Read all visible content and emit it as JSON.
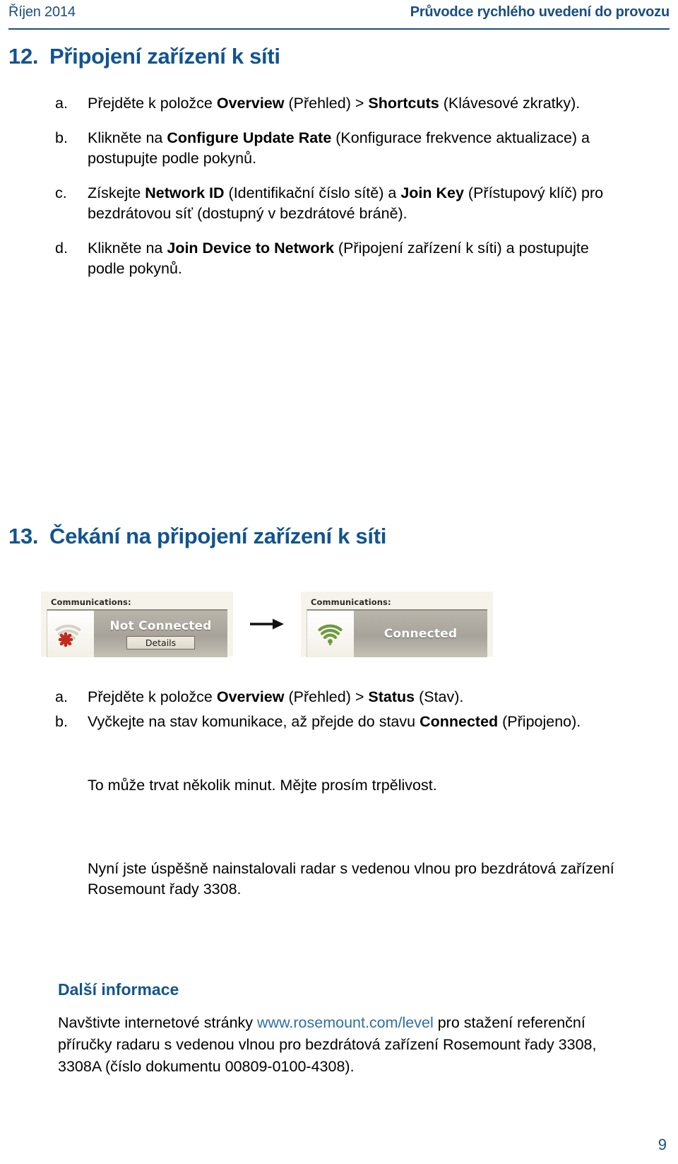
{
  "header": {
    "left": "Říjen 2014",
    "right": "Průvodce rychlého uvedení do provozu"
  },
  "sections": [
    {
      "number": "12.",
      "title": "Připojení zařízení k síti",
      "steps": [
        {
          "marker": "a.",
          "parts": [
            {
              "text": "Přejděte k položce ",
              "bold": false
            },
            {
              "text": "Overview",
              "bold": true
            },
            {
              "text": " (Přehled) > ",
              "bold": false
            },
            {
              "text": "Shortcuts",
              "bold": true
            },
            {
              "text": " (Klávesové zkratky).",
              "bold": false
            }
          ]
        },
        {
          "marker": "b.",
          "parts": [
            {
              "text": "Klikněte na ",
              "bold": false
            },
            {
              "text": "Configure Update Rate",
              "bold": true
            },
            {
              "text": " (Konfigurace frekvence aktualizace) a postupujte podle pokynů.",
              "bold": false
            }
          ]
        },
        {
          "marker": "c.",
          "parts": [
            {
              "text": "Získejte ",
              "bold": false
            },
            {
              "text": "Network ID",
              "bold": true
            },
            {
              "text": " (Identifikační číslo sítě) a ",
              "bold": false
            },
            {
              "text": "Join Key",
              "bold": true
            },
            {
              "text": " (Přístupový klíč) pro bezdrátovou síť (dostupný v bezdrátové bráně).",
              "bold": false
            }
          ]
        },
        {
          "marker": "d.",
          "parts": [
            {
              "text": "Klikněte na ",
              "bold": false
            },
            {
              "text": "Join Device to Network",
              "bold": true
            },
            {
              "text": " (Připojení zařízení k síti) a postupujte podle pokynů.",
              "bold": false
            }
          ]
        }
      ]
    },
    {
      "number": "13.",
      "title": "Čekání na připojení zařízení k síti",
      "steps": [
        {
          "marker": "a.",
          "parts": [
            {
              "text": "Přejděte k položce ",
              "bold": false
            },
            {
              "text": "Overview",
              "bold": true
            },
            {
              "text": " (Přehled) > ",
              "bold": false
            },
            {
              "text": "Status",
              "bold": true
            },
            {
              "text": " (Stav).",
              "bold": false
            }
          ]
        },
        {
          "marker": "b.",
          "parts": [
            {
              "text": "Vyčkejte na stav komunikace, až přejde do stavu ",
              "bold": false
            },
            {
              "text": "Connected",
              "bold": true
            },
            {
              "text": " (Připojeno).",
              "bold": false
            }
          ]
        }
      ]
    }
  ],
  "figure": {
    "left_panel": {
      "caption": "Communications:",
      "status": "Not Connected",
      "button": "Details",
      "icon": "wifi-disconnected-icon"
    },
    "arrow_icon": "right-arrow-icon",
    "right_panel": {
      "caption": "Communications:",
      "status": "Connected",
      "icon": "wifi-connected-icon"
    }
  },
  "notes": {
    "patience": "To může trvat několik minut. Mějte prosím trpělivost.",
    "success": "Nyní jste úspěšně nainstalovali radar s vedenou vlnou pro bezdrátová zařízení Rosemount řady 3308."
  },
  "more_info": {
    "heading": "Další informace",
    "text_before_link": "Navštivte internetové stránky ",
    "link": "www.rosemount.com/level",
    "text_after_link": " pro stažení referenční příručky radaru s vedenou vlnou pro bezdrátová zařízení Rosemount řady 3308, 3308A (číslo dokumentu 00809-0100-4308)."
  },
  "footer": {
    "page_number": "9"
  },
  "colors": {
    "heading_blue": "#11548f",
    "header_blue": "#1a4e7e",
    "link_blue": "#2f6ea5",
    "panel_bg": "#f6f3ea",
    "status_gray": "#a7a39a",
    "wifi_green": "#6d9b3f",
    "error_red": "#c22a1e"
  }
}
